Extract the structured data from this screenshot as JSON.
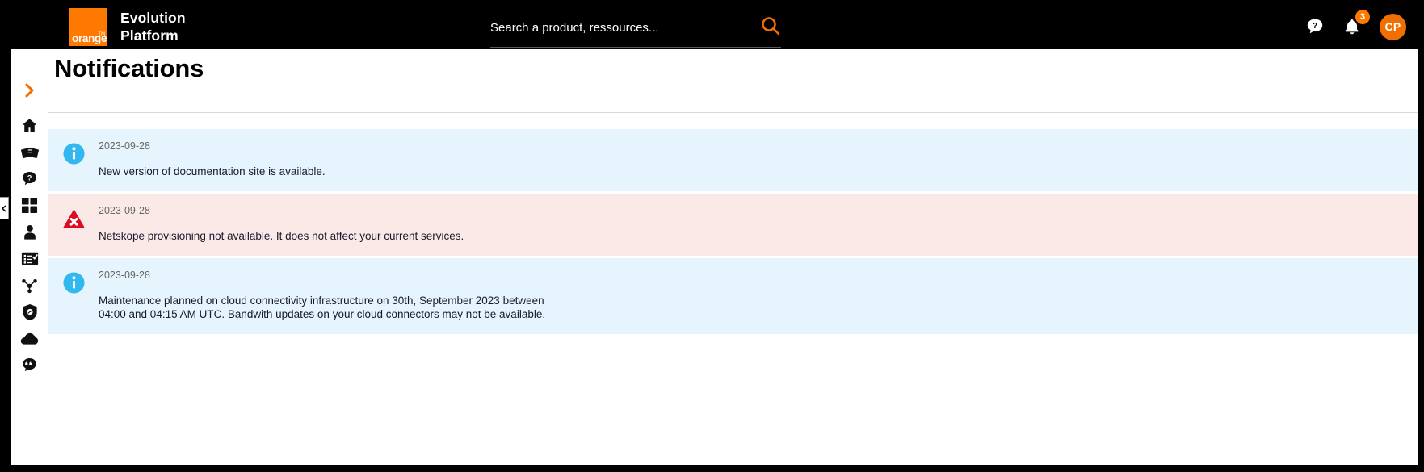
{
  "header": {
    "logo_word": "orange",
    "logo_tm": "TM",
    "brand_line1": "Evolution",
    "brand_line2": "Platform",
    "accent_color": "#ff7900",
    "background_color": "#000000"
  },
  "search": {
    "placeholder": "Search a product, ressources...",
    "value": "",
    "icon": "search-icon"
  },
  "top_right": {
    "help_icon": "help-bubble-icon",
    "bell_icon": "bell-icon",
    "notification_count": "3",
    "avatar_initials": "CP",
    "avatar_color": "#f16e00"
  },
  "sidebar": {
    "items": [
      {
        "icon": "chevron-right-icon",
        "name": "expand-sidebar"
      },
      {
        "icon": "home-icon",
        "name": "home"
      },
      {
        "icon": "cards-icon",
        "name": "catalog"
      },
      {
        "icon": "help-bubble-icon",
        "name": "support"
      },
      {
        "icon": "grid-icon",
        "name": "applications"
      },
      {
        "icon": "user-icon",
        "name": "account"
      },
      {
        "icon": "checklist-icon",
        "name": "orders"
      },
      {
        "icon": "network-icon",
        "name": "network"
      },
      {
        "icon": "shield-icon",
        "name": "security"
      },
      {
        "icon": "cloud-icon",
        "name": "cloud"
      },
      {
        "icon": "quote-bubble-icon",
        "name": "feedback"
      }
    ]
  },
  "main": {
    "title": "Notifications",
    "notifications": [
      {
        "type": "info",
        "icon": "info-circle-icon",
        "date": "2023-09-28",
        "message": "New version of documentation site is available.",
        "bg": "#e5f4fd"
      },
      {
        "type": "error",
        "icon": "error-triangle-icon",
        "date": "2023-09-28",
        "message": "Netskope provisioning not available. It does not affect your current services.",
        "bg": "#fbe9e7"
      },
      {
        "type": "info",
        "icon": "info-circle-icon",
        "date": "2023-09-28",
        "message": "Maintenance planned on cloud connectivity infrastructure on 30th, September 2023 between 04:00 and 04:15 AM UTC. Bandwith updates on your cloud connectors may not be available.",
        "bg": "#e5f4fd"
      }
    ]
  }
}
